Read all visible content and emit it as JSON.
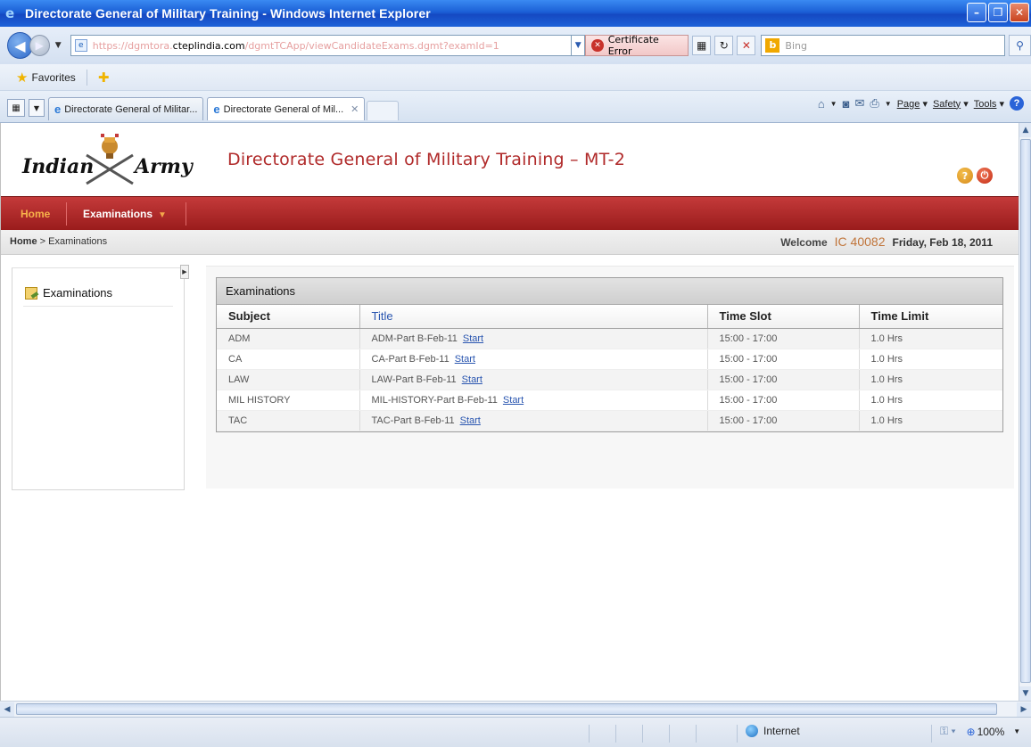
{
  "window": {
    "title": "Directorate General of Military Training - Windows Internet Explorer"
  },
  "address": {
    "url_pre": "https://dgmtora.",
    "url_host": "cteplindia.com",
    "url_post": "/dgmtTCApp/viewCandidateExams.dgmt?examId=1",
    "cert_error": "Certificate Error"
  },
  "search": {
    "placeholder": "Bing"
  },
  "favorites": {
    "label": "Favorites"
  },
  "tabs": [
    {
      "label": "Directorate General of Militar..."
    },
    {
      "label": "Directorate General of Mil..."
    }
  ],
  "commandbar": {
    "page": "Page",
    "safety": "Safety",
    "tools": "Tools"
  },
  "site": {
    "logo_word_1": "Indian",
    "logo_word_2": "Army",
    "title": "Directorate General of Military Training – MT-2"
  },
  "menu": {
    "home": "Home",
    "examinations": "Examinations"
  },
  "breadcrumb": {
    "home": "Home",
    "separator": ">",
    "current": "Examinations"
  },
  "welcome": {
    "label": "Welcome",
    "user_id": "IC 40082",
    "date": "Friday, Feb 18, 2011"
  },
  "sidebar": {
    "item": "Examinations"
  },
  "exams": {
    "panel_title": "Examinations",
    "columns": [
      "Subject",
      "Title",
      "Time Slot",
      "Time Limit"
    ],
    "start_label": "Start",
    "rows": [
      {
        "subject": "ADM",
        "title": "ADM-Part B-Feb-11",
        "slot": "15:00 - 17:00",
        "limit": "1.0 Hrs"
      },
      {
        "subject": "CA",
        "title": "CA-Part B-Feb-11",
        "slot": "15:00 - 17:00",
        "limit": "1.0 Hrs"
      },
      {
        "subject": "LAW",
        "title": "LAW-Part B-Feb-11",
        "slot": "15:00 - 17:00",
        "limit": "1.0 Hrs"
      },
      {
        "subject": "MIL HISTORY",
        "title": "MIL-HISTORY-Part B-Feb-11",
        "slot": "15:00 - 17:00",
        "limit": "1.0 Hrs"
      },
      {
        "subject": "TAC",
        "title": "TAC-Part B-Feb-11",
        "slot": "15:00 - 17:00",
        "limit": "1.0 Hrs"
      }
    ]
  },
  "status": {
    "zone": "Internet",
    "zoom": "100%"
  }
}
